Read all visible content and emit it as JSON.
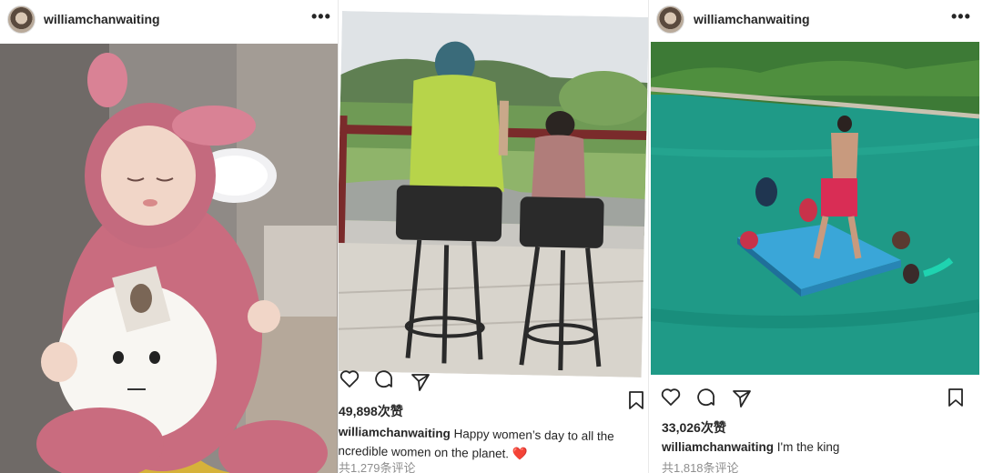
{
  "posts": [
    {
      "username": "williamchanwaiting",
      "more": "•••"
    },
    {
      "likes": "49,898次赞",
      "username": "williamchanwaiting",
      "caption_line1": "Happy women’s day to all the",
      "caption_line2": "ncredible women on the planet.",
      "caption_emoji": "❤️",
      "comments": "共1,279条评论"
    },
    {
      "username": "williamchanwaiting",
      "more": "•••",
      "likes": "33,026次赞",
      "caption": "I'm the king",
      "comments": "共1,818条评论"
    }
  ],
  "icons": [
    "heart-icon",
    "comment-icon",
    "share-icon",
    "bookmark-icon",
    "more-icon"
  ],
  "colors": {
    "text": "#262626",
    "muted": "#8e8e8e",
    "water": "#2aa79b",
    "mat": "#3aa6d8"
  }
}
